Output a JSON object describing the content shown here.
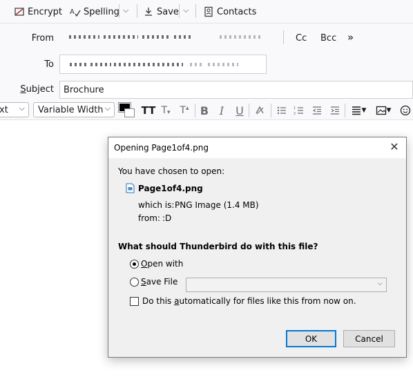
{
  "toolbar": {
    "encrypt_label": "Encrypt",
    "spelling_label": "Spelling",
    "save_label": "Save",
    "contacts_label": "Contacts"
  },
  "header": {
    "from_label": "From",
    "to_label": "To",
    "subject_label": "Subject",
    "subject_value": "Brochure",
    "cc_label": "Cc",
    "bcc_label": "Bcc",
    "more_label": "»"
  },
  "format_bar": {
    "paragraph_format_value": "xt",
    "font_value": "Variable Width",
    "text_color": "#000000",
    "bold_label": "B",
    "italic_label": "I",
    "underline_label": "U"
  },
  "dialog": {
    "title": "Opening Page1of4.png",
    "close_glyph": "✕",
    "intro_text": "You have chosen to open:",
    "file_name": "Page1of4.png",
    "which_is_label": "which is:",
    "which_is_value": "PNG Image (1.4 MB)",
    "from_label": "from:",
    "from_value": ":D",
    "question": "What should Thunderbird do with this file?",
    "open_with_label": "Open with",
    "save_file_label": "Save File",
    "auto_label": "Do this automatically for files like this from now on.",
    "ok_label": "OK",
    "cancel_label": "Cancel",
    "open_with_selected": true,
    "auto_checked": false
  }
}
